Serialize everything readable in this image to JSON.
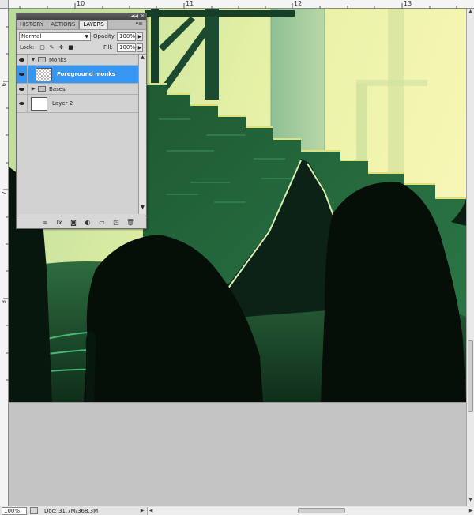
{
  "ruler": {
    "top_labels": [
      "10",
      "11",
      "12",
      "13"
    ],
    "left_labels": [
      "6",
      "7",
      "8"
    ]
  },
  "layers_panel": {
    "tabs": [
      {
        "label": "HISTORY"
      },
      {
        "label": "ACTIONS"
      },
      {
        "label": "LAYERS"
      }
    ],
    "active_tab": "LAYERS",
    "blend_mode": "Normal",
    "opacity_label": "Opacity:",
    "opacity_value": "100%",
    "lock_label": "Lock:",
    "fill_label": "Fill:",
    "fill_value": "100%",
    "layers": [
      {
        "name": "Monks",
        "type": "group",
        "expanded": true,
        "visible": true
      },
      {
        "name": "Foreground monks",
        "type": "layer",
        "selected": true,
        "visible": true
      },
      {
        "name": "Bases",
        "type": "group",
        "expanded": false,
        "visible": true
      },
      {
        "name": "Layer 2",
        "type": "layer",
        "visible": true
      }
    ],
    "footer_icons": [
      "link-icon",
      "fx-icon",
      "mask-icon",
      "adjustment-icon",
      "new-group-icon",
      "new-layer-icon",
      "trash-icon"
    ],
    "footer_fx": "fx"
  },
  "status": {
    "zoom": "100%",
    "doc_info": "Doc: 31.7M/368.3M"
  },
  "colors": {
    "selection": "#3796f2",
    "sky": "#f4f7b0",
    "canvas_green": "#1f5b33"
  }
}
